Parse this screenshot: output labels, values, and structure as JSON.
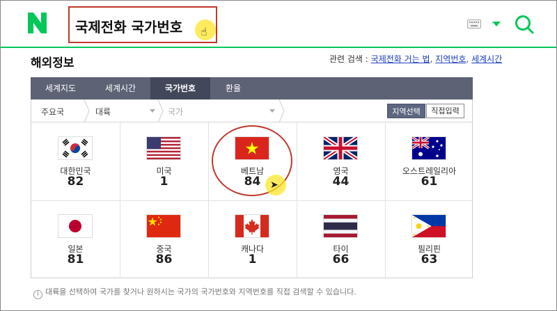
{
  "header": {
    "logo_letter": "N",
    "search_value": "국제전화 국가번호",
    "brand_color": "#03c75a",
    "icons": [
      "keyboard-icon",
      "dropdown-arrow-icon",
      "search-icon"
    ]
  },
  "section": {
    "title": "해외정보",
    "related_label": "관련 검색 :",
    "related_links": [
      "국제전화 거는 법",
      "지역번호",
      "세계시간"
    ],
    "separator": ","
  },
  "tabs": [
    {
      "label": "세계지도",
      "active": false
    },
    {
      "label": "세계시간",
      "active": false
    },
    {
      "label": "국가번호",
      "active": true
    },
    {
      "label": "환율",
      "active": false
    }
  ],
  "filter": {
    "crumb1": "주요국",
    "crumb2": "대륙",
    "crumb3": "국가",
    "region_button": "지역선택",
    "direct_button": "직접입력"
  },
  "countries": [
    {
      "name": "대한민국",
      "code": "82",
      "flag": "korea-flag-icon"
    },
    {
      "name": "미국",
      "code": "1",
      "flag": "usa-flag-icon"
    },
    {
      "name": "베트남",
      "code": "84",
      "flag": "vietnam-flag-icon"
    },
    {
      "name": "영국",
      "code": "44",
      "flag": "uk-flag-icon"
    },
    {
      "name": "오스트레일리아",
      "code": "61",
      "flag": "australia-flag-icon"
    },
    {
      "name": "일본",
      "code": "81",
      "flag": "japan-flag-icon"
    },
    {
      "name": "중국",
      "code": "86",
      "flag": "china-flag-icon"
    },
    {
      "name": "캐나다",
      "code": "1",
      "flag": "canada-flag-icon"
    },
    {
      "name": "타이",
      "code": "66",
      "flag": "thailand-flag-icon"
    },
    {
      "name": "필리핀",
      "code": "63",
      "flag": "philippines-flag-icon"
    }
  ],
  "notice": {
    "icon": "i",
    "text": "대륙을 선택하여 국가를 찾거나 원하시는 국가의 국가번호와 지역번호를 직접 검색할 수 있습니다."
  }
}
